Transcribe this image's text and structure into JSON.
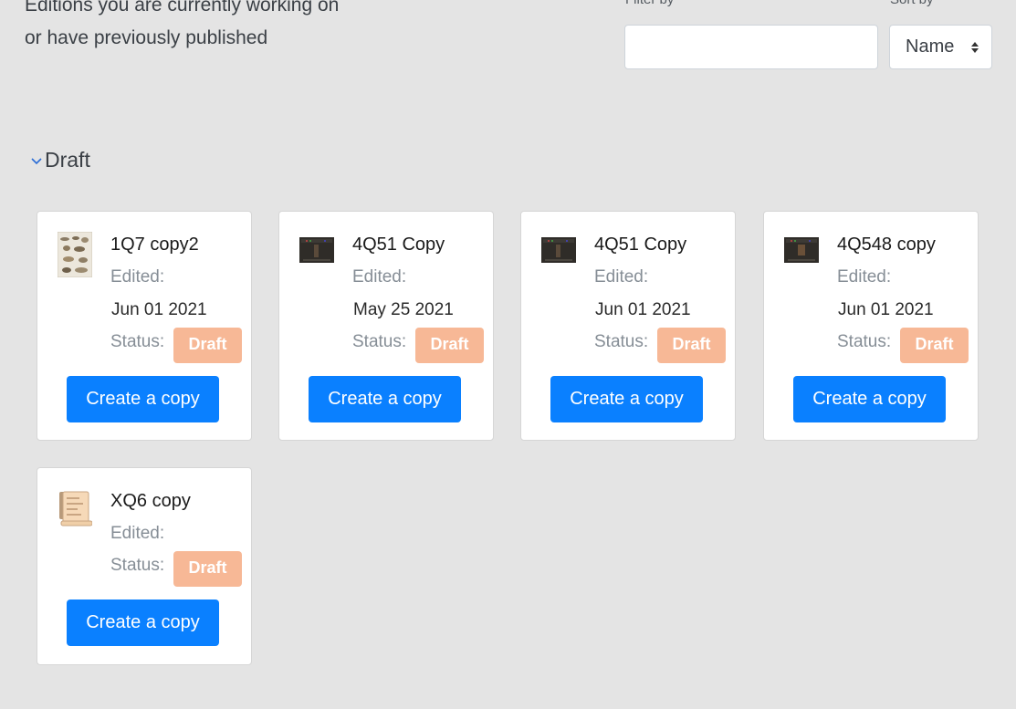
{
  "header": {
    "intro": "Editions you are currently working on or have previously published",
    "filter_label": "Filter by",
    "filter_value": "",
    "sort_label": "Sort by",
    "sort_value": "Name"
  },
  "section": {
    "title": "Draft",
    "expanded": true
  },
  "cards": [
    {
      "title": "1Q7 copy2",
      "edited_label": "Edited:",
      "edited_date": "Jun 01 2021",
      "status_label": "Status:",
      "status": "Draft",
      "button": "Create a copy",
      "thumb": "fragments-thumbnail-icon"
    },
    {
      "title": "4Q51 Copy",
      "edited_label": "Edited:",
      "edited_date": "May 25 2021",
      "status_label": "Status:",
      "status": "Draft",
      "button": "Create a copy",
      "thumb": "scroll-image-thumbnail-icon"
    },
    {
      "title": "4Q51 Copy",
      "edited_label": "Edited:",
      "edited_date": "Jun 01 2021",
      "status_label": "Status:",
      "status": "Draft",
      "button": "Create a copy",
      "thumb": "scroll-image-thumbnail-icon"
    },
    {
      "title": "4Q548 copy",
      "edited_label": "Edited:",
      "edited_date": "Jun 01 2021",
      "status_label": "Status:",
      "status": "Draft",
      "button": "Create a copy",
      "thumb": "scroll-image-thumbnail-icon"
    },
    {
      "title": "XQ6 copy",
      "edited_label": "Edited:",
      "edited_date": "",
      "status_label": "Status:",
      "status": "Draft",
      "button": "Create a copy",
      "thumb": "parchment-scroll-icon"
    }
  ],
  "colors": {
    "background": "#e4e4e4",
    "primary_button": "#0a80ff",
    "draft_badge": "#f7b896",
    "muted_text": "#868e96"
  }
}
